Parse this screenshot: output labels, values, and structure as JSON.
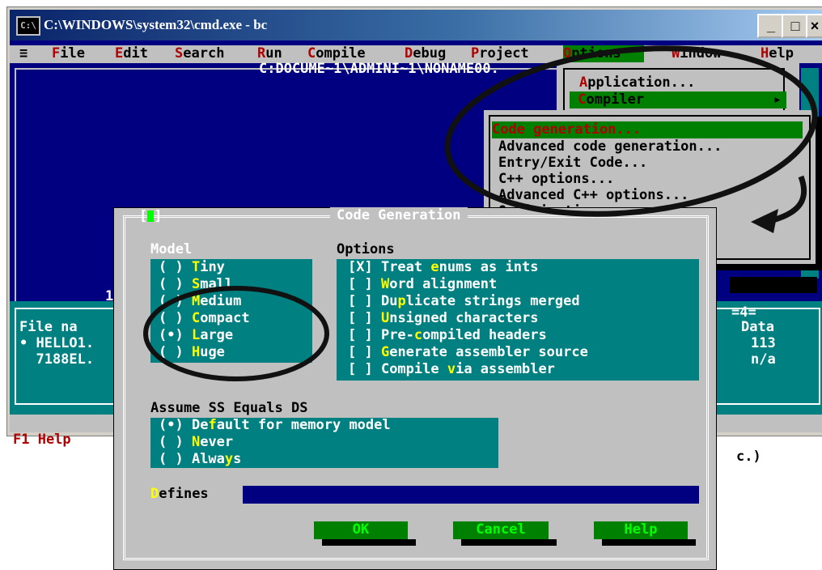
{
  "window": {
    "title": "C:\\WINDOWS\\system32\\cmd.exe - bc",
    "icon": "cmd-icon",
    "buttons": {
      "minimize": "_",
      "maximize": "□",
      "close": "×"
    }
  },
  "menubar": {
    "system": "≡",
    "items": [
      "File",
      "Edit",
      "Search",
      "Run",
      "Compile",
      "Debug",
      "Project",
      "Options",
      "Window",
      "Help"
    ],
    "visible": [
      "File",
      "Edit",
      "Search",
      "Run",
      "Compile",
      "Debug",
      "roject",
      "Options",
      "Window",
      "He"
    ]
  },
  "editor": {
    "title": "C:DOCUME~1\\ADMINI~1\\NONAME00."
  },
  "options_menu": {
    "items": [
      {
        "label": "Application...",
        "first": "A",
        "rest": "pplication..."
      },
      {
        "label": "Compiler",
        "first": "C",
        "rest": "ompiler",
        "arrow": "▸"
      }
    ]
  },
  "compiler_menu": {
    "items": [
      {
        "label": "Code generation..."
      },
      {
        "label": "Advanced code generation..."
      },
      {
        "label": "Entry/Exit Code..."
      },
      {
        "label": "C++ options..."
      },
      {
        "label": "Advanced C++ options..."
      },
      {
        "label": "Optimizations"
      }
    ]
  },
  "background_panel": {
    "left_col": [
      "File na",
      "• HELLO1.",
      "  7188EL."
    ],
    "right_col": [
      "Data",
      "113",
      "n/a"
    ],
    "status_left": "F1 Help",
    "status_right": "c.)",
    "line_number": "1",
    "window_num": "4"
  },
  "dialog": {
    "title": "Code Generation",
    "model": {
      "label": "Model",
      "options": [
        {
          "label": "Tiny",
          "hotkey_index": 0,
          "selected": false
        },
        {
          "label": "Small",
          "hotkey_index": 0,
          "selected": false
        },
        {
          "label": "Medium",
          "hotkey_index": 0,
          "selected": false
        },
        {
          "label": "Compact",
          "hotkey_index": 0,
          "selected": false
        },
        {
          "label": "Large",
          "hotkey_index": 0,
          "selected": true
        },
        {
          "label": "Huge",
          "hotkey_index": 0,
          "selected": false
        }
      ]
    },
    "options": {
      "label": "Options",
      "items": [
        {
          "label": "Treat enums as ints",
          "checked": true
        },
        {
          "label": "Word alignment",
          "checked": false
        },
        {
          "label": "Duplicate strings merged",
          "checked": false
        },
        {
          "label": "Unsigned characters",
          "checked": false
        },
        {
          "label": "Pre-compiled headers",
          "checked": false
        },
        {
          "label": "Generate assembler source",
          "checked": false
        },
        {
          "label": "Compile via assembler",
          "checked": false
        }
      ]
    },
    "assume_ss": {
      "label": "Assume SS Equals DS",
      "options": [
        {
          "label": "Default for memory model",
          "selected": true
        },
        {
          "label": "Never",
          "selected": false
        },
        {
          "label": "Always",
          "selected": false
        }
      ]
    },
    "defines": {
      "label": "Defines",
      "value": ""
    },
    "buttons": {
      "ok": "OK",
      "cancel": "Cancel",
      "help": "Help"
    }
  },
  "colors": {
    "dos_blue": "#000080",
    "dos_teal": "#008080",
    "dos_gray": "#c0c0c0",
    "dos_green": "#008000",
    "hotkey_yellow": "#ffff00",
    "hotkey_red": "#b00000"
  }
}
